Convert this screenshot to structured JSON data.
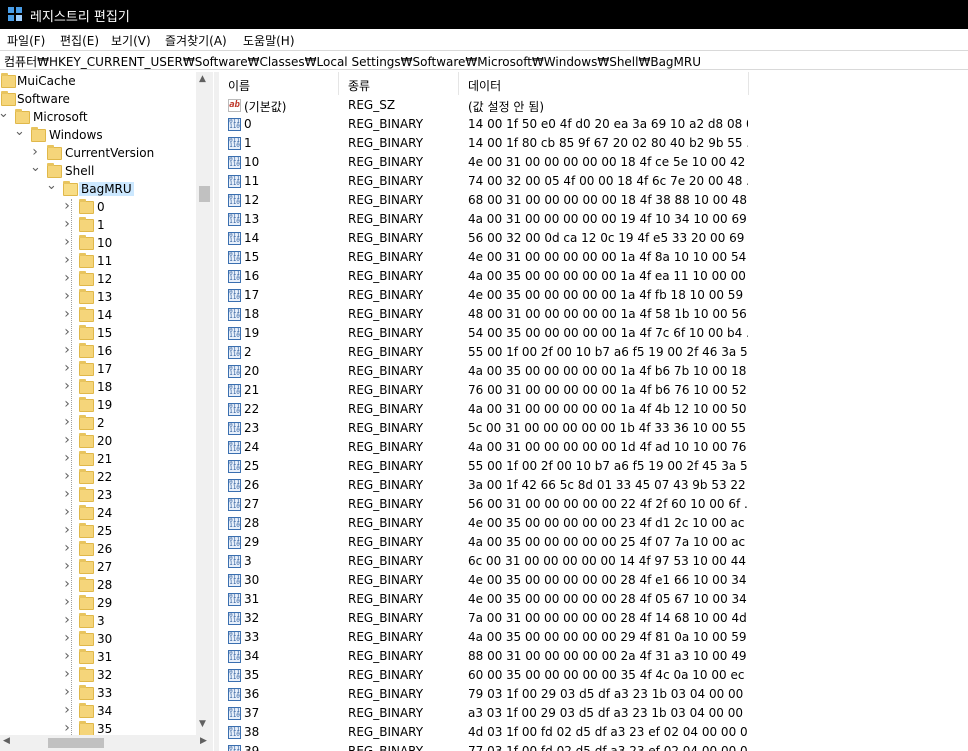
{
  "window": {
    "title": "레지스트리 편집기"
  },
  "menu": [
    "파일(F)",
    "편집(E)",
    "보기(V)",
    "즐겨찾기(A)",
    "도움말(H)"
  ],
  "address": "컴퓨터₩HKEY_CURRENT_USER₩Software₩Classes₩Local Settings₩Software₩Microsoft₩Windows₩Shell₩BagMRU",
  "tree": {
    "items": [
      {
        "label": "MuiCache",
        "level": 0
      },
      {
        "label": "Software",
        "level": 0
      },
      {
        "label": "Microsoft",
        "level": 1,
        "expanded": true
      },
      {
        "label": "Windows",
        "level": 2,
        "expanded": true
      },
      {
        "label": "CurrentVersion",
        "level": 3
      },
      {
        "label": "Shell",
        "level": 3,
        "expanded": true
      },
      {
        "label": "BagMRU",
        "level": 4,
        "expanded": true,
        "selected": true
      },
      {
        "label": "0",
        "level": 5
      },
      {
        "label": "1",
        "level": 5
      },
      {
        "label": "10",
        "level": 5
      },
      {
        "label": "11",
        "level": 5
      },
      {
        "label": "12",
        "level": 5
      },
      {
        "label": "13",
        "level": 5
      },
      {
        "label": "14",
        "level": 5
      },
      {
        "label": "15",
        "level": 5
      },
      {
        "label": "16",
        "level": 5
      },
      {
        "label": "17",
        "level": 5
      },
      {
        "label": "18",
        "level": 5
      },
      {
        "label": "19",
        "level": 5
      },
      {
        "label": "2",
        "level": 5
      },
      {
        "label": "20",
        "level": 5
      },
      {
        "label": "21",
        "level": 5
      },
      {
        "label": "22",
        "level": 5
      },
      {
        "label": "23",
        "level": 5
      },
      {
        "label": "24",
        "level": 5
      },
      {
        "label": "25",
        "level": 5
      },
      {
        "label": "26",
        "level": 5
      },
      {
        "label": "27",
        "level": 5
      },
      {
        "label": "28",
        "level": 5
      },
      {
        "label": "29",
        "level": 5
      },
      {
        "label": "3",
        "level": 5
      },
      {
        "label": "30",
        "level": 5
      },
      {
        "label": "31",
        "level": 5
      },
      {
        "label": "32",
        "level": 5
      },
      {
        "label": "33",
        "level": 5
      },
      {
        "label": "34",
        "level": 5
      },
      {
        "label": "35",
        "level": 5
      }
    ]
  },
  "list": {
    "columns": [
      "이름",
      "종류",
      "데이터"
    ],
    "rows": [
      {
        "name": "(기본값)",
        "type": "REG_SZ",
        "data": "(값 설정 안 됨)",
        "icon": "string-value-icon"
      },
      {
        "name": "0",
        "type": "REG_BINARY",
        "data": "14 00 1f 50 e0 4f d0 20 ea 3a 69 10 a2 d8 08 0...",
        "icon": "binary-value-icon"
      },
      {
        "name": "1",
        "type": "REG_BINARY",
        "data": "14 00 1f 80 cb 85 9f 67 20 02 80 40 b2 9b 55 ...",
        "icon": "binary-value-icon"
      },
      {
        "name": "10",
        "type": "REG_BINARY",
        "data": "4e 00 31 00 00 00 00 00 18 4f ce 5e 10 00 42 ...",
        "icon": "binary-value-icon"
      },
      {
        "name": "11",
        "type": "REG_BINARY",
        "data": "74 00 32 00 05 4f 00 00 18 4f 6c 7e 20 00 48 ...",
        "icon": "binary-value-icon"
      },
      {
        "name": "12",
        "type": "REG_BINARY",
        "data": "68 00 31 00 00 00 00 00 18 4f 38 88 10 00 48 ...",
        "icon": "binary-value-icon"
      },
      {
        "name": "13",
        "type": "REG_BINARY",
        "data": "4a 00 31 00 00 00 00 00 19 4f 10 34 10 00 69 ...",
        "icon": "binary-value-icon"
      },
      {
        "name": "14",
        "type": "REG_BINARY",
        "data": "56 00 32 00 0d ca 12 0c 19 4f e5 33 20 00 69 ...",
        "icon": "binary-value-icon"
      },
      {
        "name": "15",
        "type": "REG_BINARY",
        "data": "4e 00 31 00 00 00 00 00 1a 4f 8a 10 10 00 54 ...",
        "icon": "binary-value-icon"
      },
      {
        "name": "16",
        "type": "REG_BINARY",
        "data": "4a 00 35 00 00 00 00 00 1a 4f ea 11 10 00 00 ...",
        "icon": "binary-value-icon"
      },
      {
        "name": "17",
        "type": "REG_BINARY",
        "data": "4e 00 35 00 00 00 00 00 1a 4f fb 18 10 00 59 ...",
        "icon": "binary-value-icon"
      },
      {
        "name": "18",
        "type": "REG_BINARY",
        "data": "48 00 31 00 00 00 00 00 1a 4f 58 1b 10 00 56 ...",
        "icon": "binary-value-icon"
      },
      {
        "name": "19",
        "type": "REG_BINARY",
        "data": "54 00 35 00 00 00 00 00 1a 4f 7c 6f 10 00 b4 ...",
        "icon": "binary-value-icon"
      },
      {
        "name": "2",
        "type": "REG_BINARY",
        "data": "55 00 1f 00 2f 00 10 b7 a6 f5 19 00 2f 46 3a 5...",
        "icon": "binary-value-icon"
      },
      {
        "name": "20",
        "type": "REG_BINARY",
        "data": "4a 00 35 00 00 00 00 00 1a 4f b6 7b 10 00 18 ...",
        "icon": "binary-value-icon"
      },
      {
        "name": "21",
        "type": "REG_BINARY",
        "data": "76 00 31 00 00 00 00 00 1a 4f b6 76 10 00 52 ...",
        "icon": "binary-value-icon"
      },
      {
        "name": "22",
        "type": "REG_BINARY",
        "data": "4a 00 31 00 00 00 00 00 1a 4f 4b 12 10 00 50 ...",
        "icon": "binary-value-icon"
      },
      {
        "name": "23",
        "type": "REG_BINARY",
        "data": "5c 00 31 00 00 00 00 00 1b 4f 33 36 10 00 55 ...",
        "icon": "binary-value-icon"
      },
      {
        "name": "24",
        "type": "REG_BINARY",
        "data": "4a 00 31 00 00 00 00 00 1d 4f ad 10 10 00 76 ...",
        "icon": "binary-value-icon"
      },
      {
        "name": "25",
        "type": "REG_BINARY",
        "data": "55 00 1f 00 2f 00 10 b7 a6 f5 19 00 2f 45 3a 5...",
        "icon": "binary-value-icon"
      },
      {
        "name": "26",
        "type": "REG_BINARY",
        "data": "3a 00 1f 42 66 5c 8d 01 33 45 07 43 9b 53 22 ...",
        "icon": "binary-value-icon"
      },
      {
        "name": "27",
        "type": "REG_BINARY",
        "data": "56 00 31 00 00 00 00 00 22 4f 2f 60 10 00 6f ...",
        "icon": "binary-value-icon"
      },
      {
        "name": "28",
        "type": "REG_BINARY",
        "data": "4e 00 35 00 00 00 00 00 23 4f d1 2c 10 00 ac ...",
        "icon": "binary-value-icon"
      },
      {
        "name": "29",
        "type": "REG_BINARY",
        "data": "4a 00 35 00 00 00 00 00 25 4f 07 7a 10 00 ac ...",
        "icon": "binary-value-icon"
      },
      {
        "name": "3",
        "type": "REG_BINARY",
        "data": "6c 00 31 00 00 00 00 00 14 4f 97 53 10 00 44 ...",
        "icon": "binary-value-icon"
      },
      {
        "name": "30",
        "type": "REG_BINARY",
        "data": "4e 00 35 00 00 00 00 00 28 4f e1 66 10 00 34 ...",
        "icon": "binary-value-icon"
      },
      {
        "name": "31",
        "type": "REG_BINARY",
        "data": "4e 00 35 00 00 00 00 00 28 4f 05 67 10 00 34 ...",
        "icon": "binary-value-icon"
      },
      {
        "name": "32",
        "type": "REG_BINARY",
        "data": "7a 00 31 00 00 00 00 00 28 4f 14 68 10 00 4d ...",
        "icon": "binary-value-icon"
      },
      {
        "name": "33",
        "type": "REG_BINARY",
        "data": "4a 00 35 00 00 00 00 00 29 4f 81 0a 10 00 59 ...",
        "icon": "binary-value-icon"
      },
      {
        "name": "34",
        "type": "REG_BINARY",
        "data": "88 00 31 00 00 00 00 00 2a 4f 31 a3 10 00 49 ...",
        "icon": "binary-value-icon"
      },
      {
        "name": "35",
        "type": "REG_BINARY",
        "data": "60 00 35 00 00 00 00 00 35 4f 4c 0a 10 00 ec ...",
        "icon": "binary-value-icon"
      },
      {
        "name": "36",
        "type": "REG_BINARY",
        "data": "79 03 1f 00 29 03 d5 df a3 23 1b 03 04 00 00 ...",
        "icon": "binary-value-icon"
      },
      {
        "name": "37",
        "type": "REG_BINARY",
        "data": "a3 03 1f 00 29 03 d5 df a3 23 1b 03 04 00 00 ...",
        "icon": "binary-value-icon"
      },
      {
        "name": "38",
        "type": "REG_BINARY",
        "data": "4d 03 1f 00 fd 02 d5 df a3 23 ef 02 04 00 00 0...",
        "icon": "binary-value-icon"
      },
      {
        "name": "39",
        "type": "REG_BINARY",
        "data": "77 03 1f 00 fd 02 d5 df a3 23 ef 02 04 00 00 0...",
        "icon": "binary-value-icon"
      }
    ]
  },
  "colors": {
    "titlebar": "#000000",
    "selection": "#cce8ff",
    "folder": "#f5d57a"
  }
}
